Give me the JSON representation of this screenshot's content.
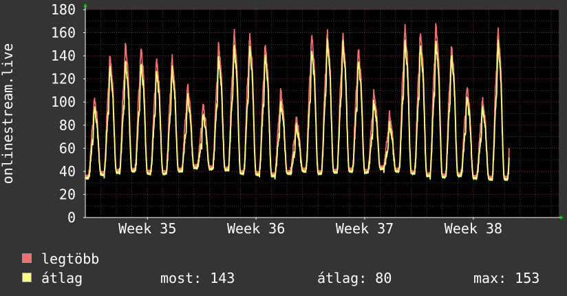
{
  "chart_data": {
    "type": "line",
    "ylabel": "onlinestream.live",
    "ylim": [
      0,
      180
    ],
    "yticks": [
      0,
      20,
      40,
      60,
      80,
      100,
      120,
      140,
      160,
      180
    ],
    "x_ticks": [
      "Week 35",
      "Week 36",
      "Week 37",
      "Week 38"
    ],
    "grid": true,
    "x_domain_days": [
      0,
      30.5
    ],
    "week_tick_days": [
      4,
      11,
      18,
      25
    ],
    "day_peak_max": [
      103,
      140,
      150,
      147,
      137,
      138,
      115,
      98,
      150,
      160,
      158,
      150,
      110,
      87,
      158,
      160,
      158,
      146,
      109,
      90,
      165,
      160,
      167,
      148,
      113,
      102,
      162
    ],
    "day_peak_avg": [
      95,
      130,
      135,
      133,
      127,
      128,
      105,
      90,
      138,
      148,
      147,
      140,
      100,
      80,
      145,
      152,
      150,
      136,
      100,
      82,
      152,
      148,
      152,
      140,
      105,
      95,
      150
    ],
    "day_trough": [
      36,
      39,
      41,
      42,
      40,
      40,
      42,
      45,
      44,
      43,
      40,
      39,
      38,
      40,
      42,
      40,
      41,
      42,
      41,
      44,
      42,
      40,
      38,
      37,
      38,
      36,
      35
    ],
    "series": [
      {
        "name": "legtöbb",
        "color": "#f07070"
      },
      {
        "name": "átlag",
        "color": "#ffff88"
      }
    ]
  },
  "legend": {
    "max_label": "legtöbb",
    "avg_label": "átlag"
  },
  "stats": {
    "most": "most: 143",
    "atlag": "átlag: 80",
    "max": "max: 153"
  },
  "colors": {
    "background": "#343434",
    "plot_background": "#000000",
    "axis": "#ffffff",
    "grid_major": "#8b2020",
    "grid_minor": "#3a3a3a",
    "arrow": "#00cc00"
  }
}
